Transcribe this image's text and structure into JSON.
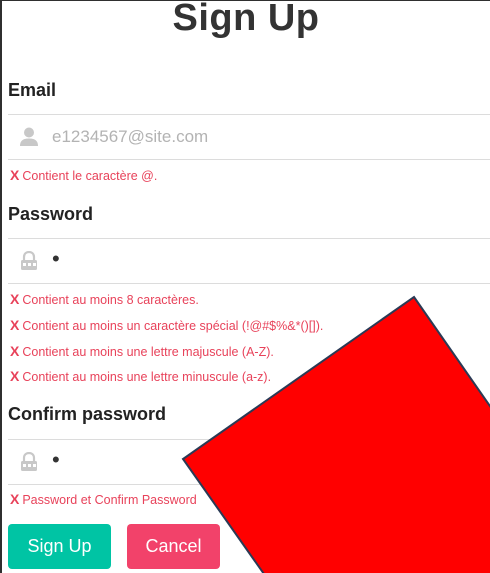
{
  "form": {
    "title": "Sign Up",
    "email": {
      "label": "Email",
      "placeholder": "e1234567@site.com",
      "icon": "user-icon",
      "errors": [
        "Contient le caractère @."
      ]
    },
    "password": {
      "label": "Password",
      "value": "•",
      "icon": "lock-icon",
      "errors": [
        "Contient au moins 8 caractères.",
        "Contient au moins un caractère spécial (!@#$%&*()[]).",
        "Contient au moins une lettre majuscule (A-Z).",
        "Contient au moins une lettre minuscule (a-z)."
      ]
    },
    "confirm": {
      "label": "Confirm password",
      "value": "•",
      "icon": "lock-icon",
      "errors": [
        "Password et Confirm Password"
      ]
    },
    "error_mark": "X",
    "buttons": {
      "signup": "Sign Up",
      "cancel": "Cancel"
    }
  },
  "colors": {
    "signup_button": "#00c4a4",
    "cancel_button": "#f2426a",
    "error_text": "#e8425a",
    "overlay_shape": "#ff0000"
  }
}
